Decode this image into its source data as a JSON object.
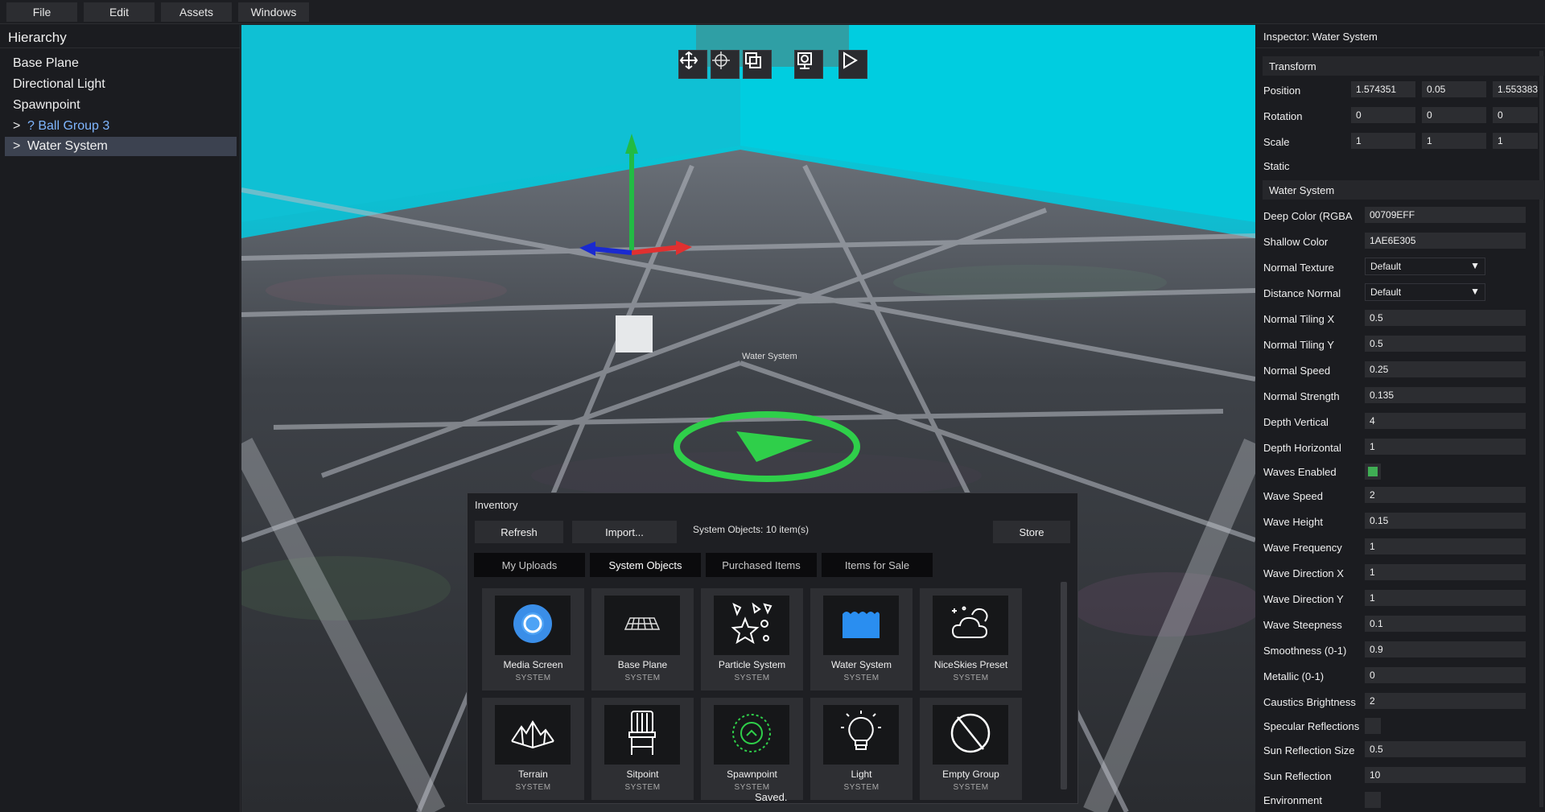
{
  "menu": [
    {
      "label": "File"
    },
    {
      "label": "Edit"
    },
    {
      "label": "Assets"
    },
    {
      "label": "Windows"
    }
  ],
  "hierarchy": {
    "title": "Hierarchy",
    "items": [
      {
        "label": "Base Plane",
        "expander": ""
      },
      {
        "label": "Directional Light",
        "expander": ""
      },
      {
        "label": "Spawnpoint",
        "expander": ""
      },
      {
        "label": "? Ball Group 3",
        "expander": ">"
      },
      {
        "label": "Water System",
        "expander": ">"
      }
    ]
  },
  "viewport": {
    "object_label": "Water System",
    "tools": [
      "move-tool-icon",
      "pivot-tool-icon",
      "scale-tool-icon",
      "camera-tool-icon",
      "play-icon"
    ],
    "colors": {
      "water": "#00c8d8",
      "axis_x": "#e03030",
      "axis_y": "#22bb44",
      "axis_z": "#1a2ad0",
      "spawn_ring": "#2fcf4a"
    }
  },
  "inventory": {
    "title": "Inventory",
    "refresh_label": "Refresh",
    "import_label": "Import...",
    "count_text": "System Objects: 10 item(s)",
    "store_label": "Store",
    "tabs": [
      {
        "label": "My Uploads"
      },
      {
        "label": "System Objects"
      },
      {
        "label": "Purchased Items"
      },
      {
        "label": "Items for Sale"
      }
    ],
    "items": [
      {
        "name": "Media Screen",
        "type": "SYSTEM",
        "icon": "media-screen-icon"
      },
      {
        "name": "Base Plane",
        "type": "SYSTEM",
        "icon": "base-plane-icon"
      },
      {
        "name": "Particle System",
        "type": "SYSTEM",
        "icon": "particle-system-icon"
      },
      {
        "name": "Water System",
        "type": "SYSTEM",
        "icon": "water-system-icon"
      },
      {
        "name": "NiceSkies Preset",
        "type": "SYSTEM",
        "icon": "niceskies-icon"
      },
      {
        "name": "Terrain",
        "type": "SYSTEM",
        "icon": "terrain-icon"
      },
      {
        "name": "Sitpoint",
        "type": "SYSTEM",
        "icon": "sitpoint-icon"
      },
      {
        "name": "Spawnpoint",
        "type": "SYSTEM",
        "icon": "spawnpoint-icon"
      },
      {
        "name": "Light",
        "type": "SYSTEM",
        "icon": "light-bulb-icon"
      },
      {
        "name": "Empty Group",
        "type": "SYSTEM",
        "icon": "empty-group-icon"
      }
    ],
    "status": "Saved."
  },
  "inspector": {
    "title": "Inspector: Water System",
    "transform": {
      "section": "Transform",
      "position_label": "Position",
      "position": [
        "1.574351",
        "0.05",
        "1.553383"
      ],
      "rotation_label": "Rotation",
      "rotation": [
        "0",
        "0",
        "0"
      ],
      "scale_label": "Scale",
      "scale": [
        "1",
        "1",
        "1"
      ],
      "static_label": "Static"
    },
    "water": {
      "section": "Water System",
      "deep_color_label": "Deep Color (RGBA",
      "deep_color": "00709EFF",
      "shallow_color_label": "Shallow Color",
      "shallow_color": "1AE6E305",
      "normal_texture_label": "Normal Texture",
      "normal_texture": "Default",
      "distance_normal_label": "Distance Normal",
      "distance_normal": "Default",
      "normal_tiling_x_label": "Normal Tiling X",
      "normal_tiling_x": "0.5",
      "normal_tiling_y_label": "Normal Tiling Y",
      "normal_tiling_y": "0.5",
      "normal_speed_label": "Normal Speed",
      "normal_speed": "0.25",
      "normal_strength_label": "Normal Strength",
      "normal_strength": "0.135",
      "depth_vertical_label": "Depth Vertical",
      "depth_vertical": "4",
      "depth_horizontal_label": "Depth Horizontal",
      "depth_horizontal": "1",
      "waves_enabled_label": "Waves Enabled",
      "waves_enabled": true,
      "wave_speed_label": "Wave Speed",
      "wave_speed": "2",
      "wave_height_label": "Wave Height",
      "wave_height": "0.15",
      "wave_frequency_label": "Wave Frequency",
      "wave_frequency": "1",
      "wave_direction_x_label": "Wave Direction X",
      "wave_direction_x": "1",
      "wave_direction_y_label": "Wave Direction Y",
      "wave_direction_y": "1",
      "wave_steepness_label": "Wave Steepness",
      "wave_steepness": "0.1",
      "smoothness_label": "Smoothness (0-1)",
      "smoothness": "0.9",
      "metallic_label": "Metallic (0-1)",
      "metallic": "0",
      "caustics_brightness_label": "Caustics Brightness",
      "caustics_brightness": "2",
      "specular_reflections_label": "Specular Reflections",
      "specular_reflections": false,
      "sun_reflection_size_label": "Sun Reflection Size",
      "sun_reflection_size": "0.5",
      "sun_reflection_label": "Sun Reflection",
      "sun_reflection": "10",
      "environment_label": "Environment",
      "environment": false
    },
    "accent_check_color": "#3fae54"
  }
}
